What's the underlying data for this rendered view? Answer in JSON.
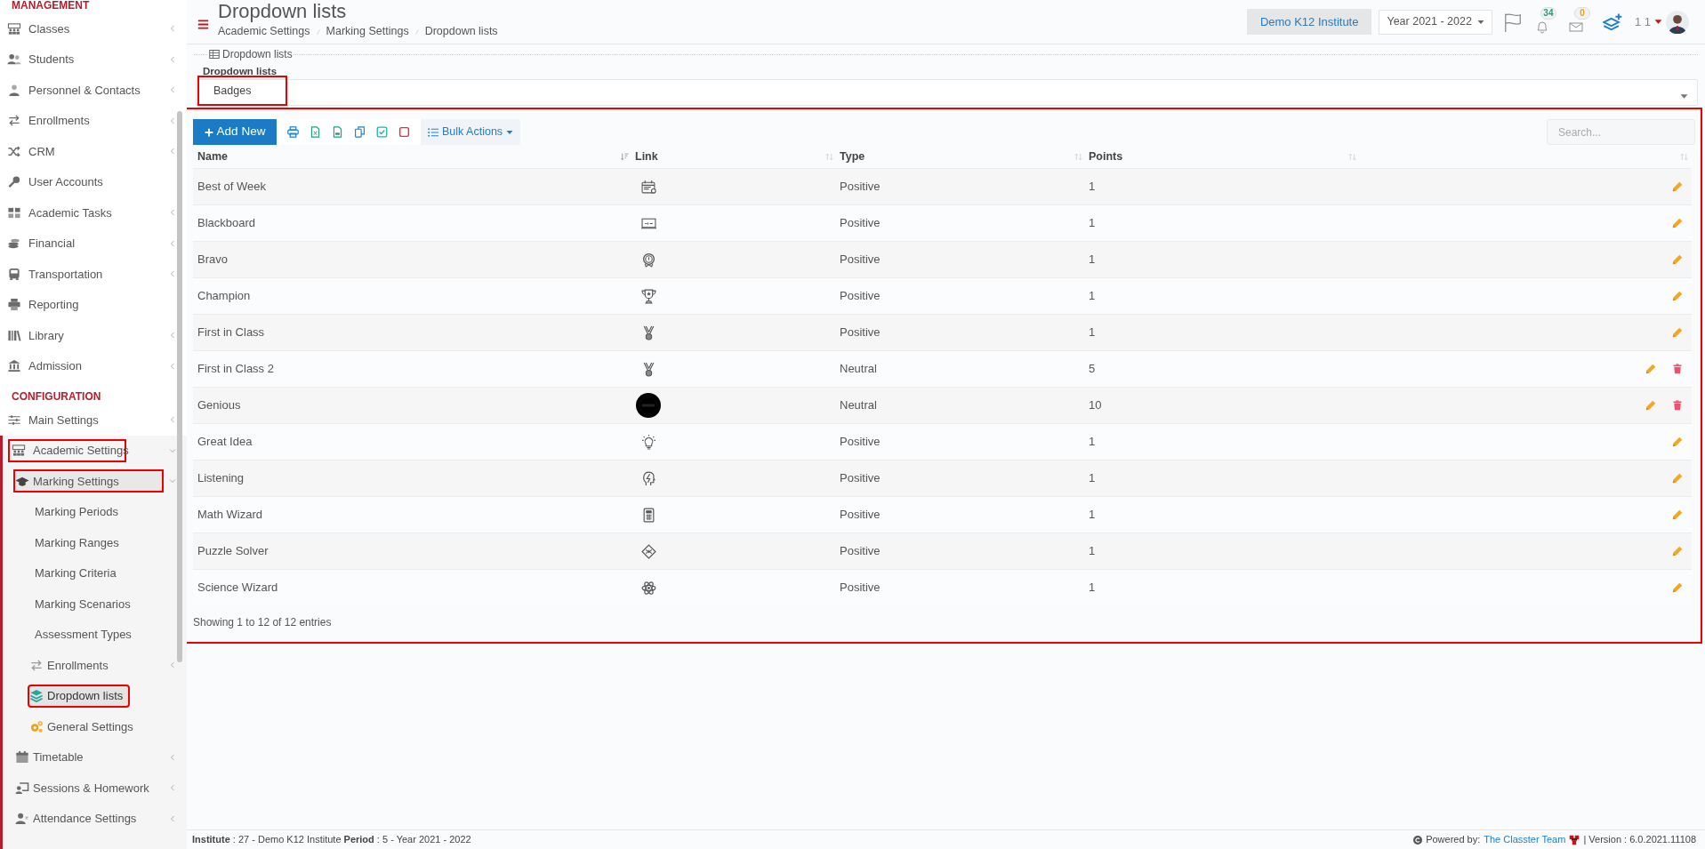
{
  "sidebar": {
    "sections": [
      {
        "title": "MANAGEMENT",
        "items": [
          {
            "label": "Classes",
            "submenu": true,
            "expanded": false,
            "selected": false,
            "highlighted": false
          },
          {
            "label": "Students",
            "submenu": true,
            "expanded": false,
            "selected": false,
            "highlighted": false
          },
          {
            "label": "Personnel & Contacts",
            "submenu": true,
            "expanded": false,
            "selected": false,
            "highlighted": false
          },
          {
            "label": "Enrollments",
            "submenu": true,
            "expanded": false,
            "selected": false,
            "highlighted": false
          },
          {
            "label": "CRM",
            "submenu": true,
            "expanded": false,
            "selected": false,
            "highlighted": false
          },
          {
            "label": "User Accounts",
            "submenu": false,
            "expanded": false,
            "selected": false,
            "highlighted": false
          },
          {
            "label": "Academic Tasks",
            "submenu": true,
            "expanded": false,
            "selected": false,
            "highlighted": false
          },
          {
            "label": "Financial",
            "submenu": true,
            "expanded": false,
            "selected": false,
            "highlighted": false
          },
          {
            "label": "Transportation",
            "submenu": true,
            "expanded": false,
            "selected": false,
            "highlighted": false
          },
          {
            "label": "Reporting",
            "submenu": false,
            "expanded": false,
            "selected": false,
            "highlighted": false
          },
          {
            "label": "Library",
            "submenu": true,
            "expanded": false,
            "selected": false,
            "highlighted": false
          },
          {
            "label": "Admission",
            "submenu": true,
            "expanded": false,
            "selected": false,
            "highlighted": false
          }
        ]
      },
      {
        "title": "CONFIGURATION",
        "items": [
          {
            "label": "Main Settings",
            "submenu": true,
            "expanded": false,
            "selected": false,
            "highlighted": false
          },
          {
            "label": "Academic Settings",
            "submenu": true,
            "expanded": true,
            "selected": false,
            "highlighted": true,
            "children": [
              {
                "label": "Marking Settings",
                "submenu": true,
                "expanded": true,
                "selected": false,
                "highlighted": true,
                "children": [
                  {
                    "label": "Marking Periods",
                    "submenu": false,
                    "expanded": false,
                    "selected": false,
                    "highlighted": false
                  },
                  {
                    "label": "Marking Ranges",
                    "submenu": false,
                    "expanded": false,
                    "selected": false,
                    "highlighted": false
                  },
                  {
                    "label": "Marking Criteria",
                    "submenu": false,
                    "expanded": false,
                    "selected": false,
                    "highlighted": false
                  },
                  {
                    "label": "Marking Scenarios",
                    "submenu": false,
                    "expanded": false,
                    "selected": false,
                    "highlighted": false
                  },
                  {
                    "label": "Assessment Types",
                    "submenu": false,
                    "expanded": false,
                    "selected": false,
                    "highlighted": false
                  },
                  {
                    "label": "Enrollments",
                    "submenu": true,
                    "expanded": false,
                    "selected": false,
                    "highlighted": false
                  },
                  {
                    "label": "Dropdown lists",
                    "submenu": false,
                    "expanded": false,
                    "selected": true,
                    "highlighted": true
                  },
                  {
                    "label": "General Settings",
                    "submenu": false,
                    "expanded": false,
                    "selected": false,
                    "highlighted": false
                  }
                ]
              },
              {
                "label": "Timetable",
                "submenu": true,
                "expanded": false,
                "selected": false,
                "highlighted": false
              },
              {
                "label": "Sessions & Homework",
                "submenu": true,
                "expanded": false,
                "selected": false,
                "highlighted": false
              },
              {
                "label": "Attendance Settings",
                "submenu": true,
                "expanded": false,
                "selected": false,
                "highlighted": false
              }
            ]
          }
        ]
      }
    ]
  },
  "header": {
    "title": "Dropdown lists",
    "breadcrumb": [
      "Academic Settings",
      "Marking Settings",
      "Dropdown lists"
    ],
    "institute": "Demo K12 Institute",
    "year": "Year 2021 - 2022",
    "notifications": "34",
    "messages": "0",
    "user": "1 1"
  },
  "filter": {
    "legend": "Dropdown lists",
    "label": "Dropdown lists",
    "value": "Badges",
    "highlighted": true
  },
  "table": {
    "highlighted": true,
    "toolbar": {
      "add_button": "Add New",
      "bulk_actions": "Bulk Actions",
      "search_placeholder": "Search..."
    },
    "columns": [
      {
        "label": "Name",
        "sorted": true
      },
      {
        "label": "Link",
        "sorted": false
      },
      {
        "label": "Type",
        "sorted": false
      },
      {
        "label": "Points",
        "sorted": false
      },
      {
        "sorted": false
      }
    ],
    "rows": [
      {
        "name": "Best of Week",
        "type": "Positive",
        "points": "1",
        "deletable": false,
        "kind": "icon"
      },
      {
        "name": "Blackboard",
        "type": "Positive",
        "points": "1",
        "deletable": false,
        "kind": "icon"
      },
      {
        "name": "Bravo",
        "type": "Positive",
        "points": "1",
        "deletable": false,
        "kind": "icon"
      },
      {
        "name": "Champion",
        "type": "Positive",
        "points": "1",
        "deletable": false,
        "kind": "icon"
      },
      {
        "name": "First in Class",
        "type": "Positive",
        "points": "1",
        "deletable": false,
        "kind": "icon"
      },
      {
        "name": "First in Class 2",
        "type": "Neutral",
        "points": "5",
        "deletable": true,
        "kind": "icon"
      },
      {
        "name": "Genious",
        "type": "Neutral",
        "points": "10",
        "deletable": true,
        "kind": "picture"
      },
      {
        "name": "Great Idea",
        "type": "Positive",
        "points": "1",
        "deletable": false,
        "kind": "icon"
      },
      {
        "name": "Listening",
        "type": "Positive",
        "points": "1",
        "deletable": false,
        "kind": "icon"
      },
      {
        "name": "Math Wizard",
        "type": "Positive",
        "points": "1",
        "deletable": false,
        "kind": "icon"
      },
      {
        "name": "Puzzle Solver",
        "type": "Positive",
        "points": "1",
        "deletable": false,
        "kind": "icon"
      },
      {
        "name": "Science Wizard",
        "type": "Positive",
        "points": "1",
        "deletable": false,
        "kind": "icon"
      }
    ],
    "info": "Showing 1 to 12 of 12 entries"
  },
  "footer": {
    "left": "**Institute** : 27 - Demo K12 Institute **Period** : 5 - Year 2021 - 2022",
    "powered_by": "Powered by:",
    "team_link": "The Classter Team",
    "version": "| Version : 6.0.2021.11108"
  }
}
